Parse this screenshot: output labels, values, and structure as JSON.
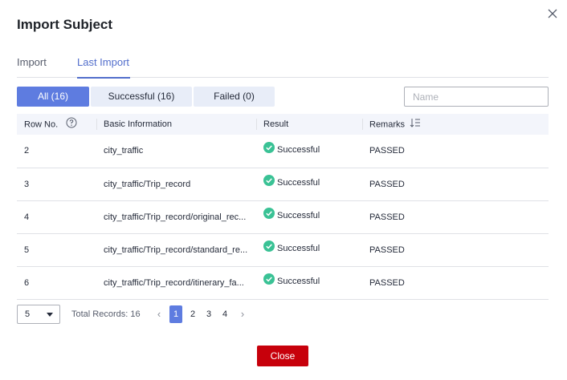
{
  "dialog": {
    "title": "Import Subject",
    "close_icon": "close-icon"
  },
  "tabs": [
    {
      "label": "Import",
      "active": false
    },
    {
      "label": "Last Import",
      "active": true
    }
  ],
  "filters": [
    {
      "label": "All (16)",
      "active": true
    },
    {
      "label": "Successful (16)",
      "active": false
    },
    {
      "label": "Failed (0)",
      "active": false
    }
  ],
  "search": {
    "placeholder": "Name",
    "value": ""
  },
  "table": {
    "headers": [
      "Row No.",
      "Basic Information",
      "Result",
      "Remarks"
    ],
    "rows": [
      {
        "row_no": "2",
        "basic_info": "city_traffic",
        "result": "Successful",
        "remarks": "PASSED"
      },
      {
        "row_no": "3",
        "basic_info": "city_traffic/Trip_record",
        "result": "Successful",
        "remarks": "PASSED"
      },
      {
        "row_no": "4",
        "basic_info": "city_traffic/Trip_record/original_rec...",
        "result": "Successful",
        "remarks": "PASSED"
      },
      {
        "row_no": "5",
        "basic_info": "city_traffic/Trip_record/standard_re...",
        "result": "Successful",
        "remarks": "PASSED"
      },
      {
        "row_no": "6",
        "basic_info": "city_traffic/Trip_record/itinerary_fa...",
        "result": "Successful",
        "remarks": "PASSED"
      }
    ]
  },
  "pagination": {
    "page_size": "5",
    "total_label": "Total Records: 16",
    "pages": [
      "1",
      "2",
      "3",
      "4"
    ],
    "current_page": "1",
    "prev": "‹",
    "next": "›"
  },
  "footer": {
    "close_label": "Close"
  },
  "colors": {
    "accent": "#5e7ce0",
    "success": "#3ac295",
    "danger": "#c7000b"
  }
}
